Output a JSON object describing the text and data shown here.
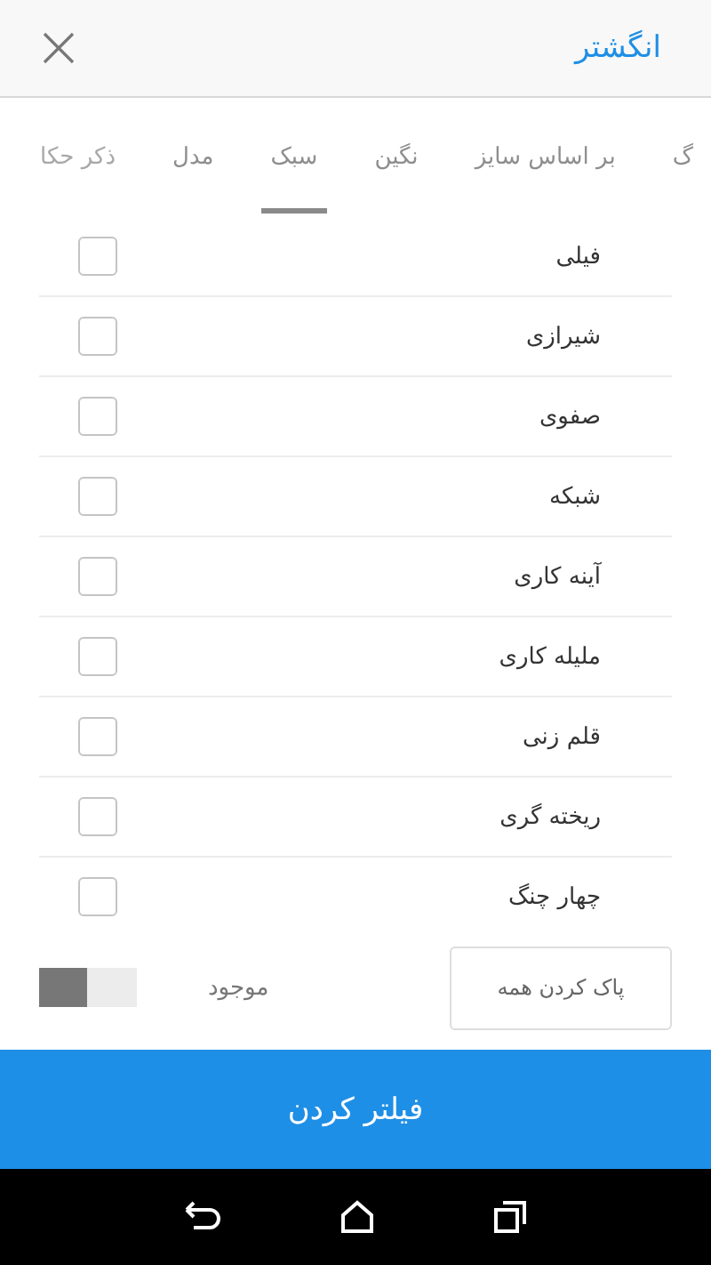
{
  "header": {
    "title": "انگشتر"
  },
  "tabs": [
    {
      "label": "گ",
      "selected": false
    },
    {
      "label": "بر اساس سایز",
      "selected": false
    },
    {
      "label": "نگین",
      "selected": false
    },
    {
      "label": "سبک",
      "selected": true
    },
    {
      "label": "مدل",
      "selected": false
    },
    {
      "label": "ذکر حکا",
      "selected": false
    }
  ],
  "options": [
    {
      "label": "فیلی",
      "checked": false
    },
    {
      "label": "شیرازی",
      "checked": false
    },
    {
      "label": "صفوی",
      "checked": false
    },
    {
      "label": "شبکه",
      "checked": false
    },
    {
      "label": "آینه کاری",
      "checked": false
    },
    {
      "label": "ملیله کاری",
      "checked": false
    },
    {
      "label": "قلم زنی",
      "checked": false
    },
    {
      "label": "ریخته گری",
      "checked": false
    },
    {
      "label": "چهار چنگ",
      "checked": false
    }
  ],
  "footer": {
    "clear_button": "پاک کردن همه",
    "in_stock": {
      "label": "موجود",
      "on": false
    }
  },
  "submit_button": "فیلتر کردن"
}
